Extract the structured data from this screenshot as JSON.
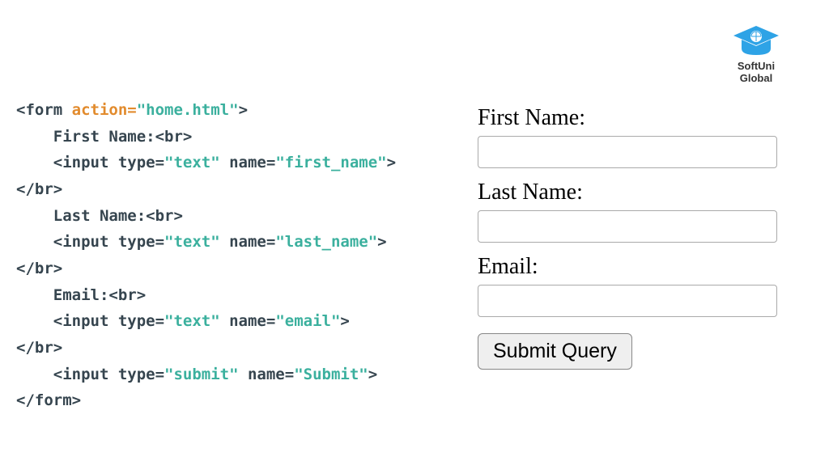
{
  "logo": {
    "line1": "SoftUni",
    "line2": "Global"
  },
  "code": {
    "l1a": "<form ",
    "l1b": "action=",
    "l1c": "\"home.html\"",
    "l1d": ">",
    "l2": "    First Name:<br>",
    "l3a": "    <input type=",
    "l3b": "\"text\"",
    "l3c": " name=",
    "l3d": "\"first_name\"",
    "l3e": ">",
    "l4": "</br>",
    "l5": "    Last Name:<br>",
    "l6a": "    <input type=",
    "l6b": "\"text\"",
    "l6c": " name=",
    "l6d": "\"last_name\"",
    "l6e": ">",
    "l7": "</br>",
    "l8": "    Email:<br>",
    "l9a": "    <input type=",
    "l9b": "\"text\"",
    "l9c": " name=",
    "l9d": "\"email\"",
    "l9e": ">",
    "l10": "</br>",
    "l11a": "    <input type=",
    "l11b": "\"submit\"",
    "l11c": " name=",
    "l11d": "\"Submit\"",
    "l11e": ">",
    "l12": "",
    "l13": "</form>"
  },
  "form": {
    "label1": "First Name:",
    "label2": "Last Name:",
    "label3": "Email:",
    "submit": "Submit Query"
  }
}
